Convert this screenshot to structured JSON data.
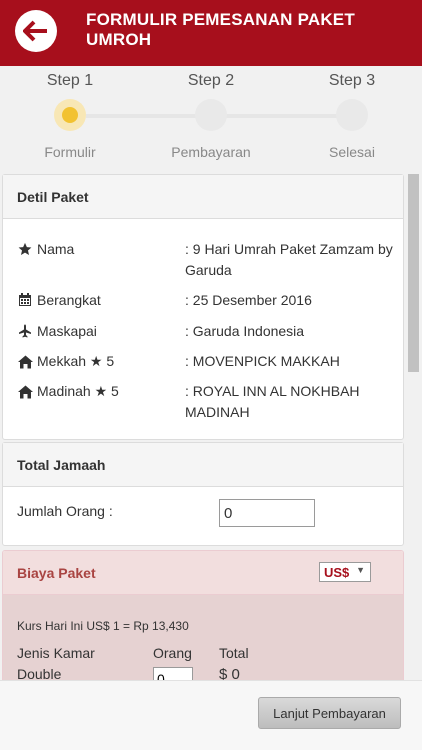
{
  "header": {
    "title": "FORMULIR PEMESANAN PAKET UMROH"
  },
  "steps": [
    {
      "title": "Step 1",
      "label": "Formulir",
      "active": true
    },
    {
      "title": "Step 2",
      "label": "Pembayaran",
      "active": false
    },
    {
      "title": "Step 3",
      "label": "Selesai",
      "active": false
    }
  ],
  "detil_paket": {
    "heading": "Detil Paket",
    "rows": [
      {
        "icon": "star-icon",
        "label": "Nama",
        "value": ": 9 Hari Umrah Paket Zamzam by Garuda"
      },
      {
        "icon": "calendar-icon",
        "label": "Berangkat",
        "value": ": 25 Desember 2016"
      },
      {
        "icon": "plane-icon",
        "label": "Maskapai",
        "value": ": Garuda Indonesia"
      },
      {
        "icon": "home-icon",
        "label": "Mekkah ★ 5",
        "value": ": MOVENPICK MAKKAH"
      },
      {
        "icon": "home-icon",
        "label": "Madinah ★ 5",
        "value": ": ROYAL INN AL NOKHBAH MADINAH"
      }
    ]
  },
  "total_jamaah": {
    "heading": "Total Jamaah",
    "label": "Jumlah Orang :",
    "value": "0"
  },
  "biaya_paket": {
    "heading": "Biaya Paket",
    "currency": "US$",
    "kurs": "Kurs Hari Ini US$ 1 = Rp 13,430",
    "col_jenis": "Jenis Kamar",
    "col_orang": "Orang",
    "col_total": "Total",
    "row_type": "Double",
    "row_orang": "0",
    "row_total": "$ 0"
  },
  "footer": {
    "next_label": "Lanjut Pembayaran"
  },
  "colors": {
    "header": "#a70f1c",
    "active_step": "#f2c230",
    "biaya_heading_bg": "#f2dede",
    "biaya_heading_text": "#a94442"
  }
}
